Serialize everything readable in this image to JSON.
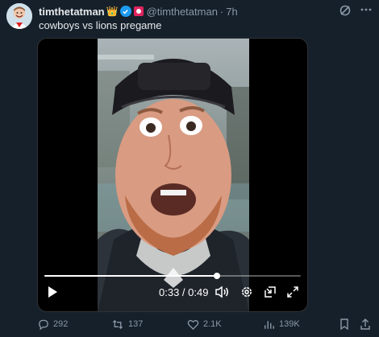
{
  "author": {
    "display_name": "timthetatman",
    "handle": "@timthetatman",
    "separator": "·",
    "time": "7h",
    "crown_glyph": "👑",
    "badge_icon": "verified-badge-icon",
    "affiliate_icon": "affiliate-badge-icon"
  },
  "tweet": {
    "text": "cowboys vs lions pregame"
  },
  "video": {
    "time_current_total": "0:33 / 0:49",
    "progress_fraction": 0.673
  },
  "actions": {
    "replies": "292",
    "reposts": "137",
    "likes": "2.1K",
    "views": "139K"
  },
  "colors": {
    "background": "#15202b",
    "text": "#e7e9ea",
    "muted": "#8b98a5",
    "accent": "#1d9bf0"
  }
}
